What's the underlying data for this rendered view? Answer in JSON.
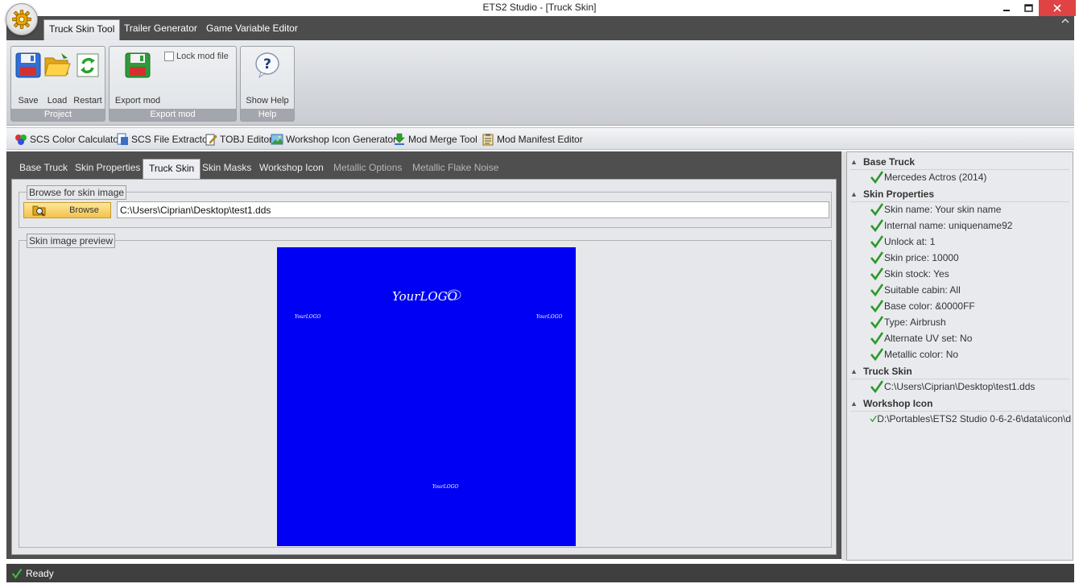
{
  "window": {
    "title": "ETS2 Studio - [Truck Skin]",
    "minimize": "–",
    "maximize": "☐",
    "close": "✕"
  },
  "ribbon": {
    "tabs": [
      "Truck Skin Tool",
      "Trailer Generator",
      "Game Variable Editor"
    ],
    "active_tab": "Truck Skin Tool",
    "groups": {
      "project": {
        "caption": "Project",
        "buttons": [
          "Save",
          "Load",
          "Restart"
        ]
      },
      "export": {
        "caption": "Export mod",
        "export_label": "Export mod",
        "lock_label": "Lock mod file",
        "lock_checked": false
      },
      "help": {
        "caption": "Help",
        "button": "Show Help"
      }
    }
  },
  "tools": [
    "SCS Color Calculator",
    "SCS File Extractor",
    "TOBJ Editor",
    "Workshop Icon Generator",
    "Mod Merge Tool",
    "Mod Manifest Editor"
  ],
  "content_tabs": [
    "Base Truck",
    "Skin Properties",
    "Truck Skin",
    "Skin Masks",
    "Workshop Icon",
    "Metallic Options",
    "Metallic Flake Noise"
  ],
  "active_content_tab": "Truck Skin",
  "browse": {
    "legend": "Browse for skin image",
    "button": "Browse",
    "path": "C:\\Users\\Ciprian\\Desktop\\test1.dds"
  },
  "preview": {
    "legend": "Skin image preview",
    "background": "#0000f5",
    "logo_text": "YourLOGO"
  },
  "summary": {
    "base_truck": {
      "title": "Base Truck",
      "items": [
        "Mercedes Actros (2014)"
      ]
    },
    "skin_properties": {
      "title": "Skin Properties",
      "items": [
        "Skin name: Your skin name",
        "Internal name: uniquename92",
        "Unlock at: 1",
        "Skin price: 10000",
        "Skin stock: Yes",
        "Suitable cabin: All",
        "Base color: &0000FF",
        "Type: Airbrush",
        "Alternate UV set: No",
        "Metallic color: No"
      ]
    },
    "truck_skin": {
      "title": "Truck Skin",
      "items": [
        "C:\\Users\\Ciprian\\Desktop\\test1.dds"
      ]
    },
    "workshop_icon": {
      "title": "Workshop Icon",
      "items": [
        "D:\\Portables\\ETS2 Studio 0-6-2-6\\data\\icon\\d"
      ]
    }
  },
  "status": {
    "text": "Ready"
  },
  "colors": {
    "accent_check": "#2a9a2a",
    "tab_dark": "#4c4c4c",
    "close_red": "#e04343"
  }
}
